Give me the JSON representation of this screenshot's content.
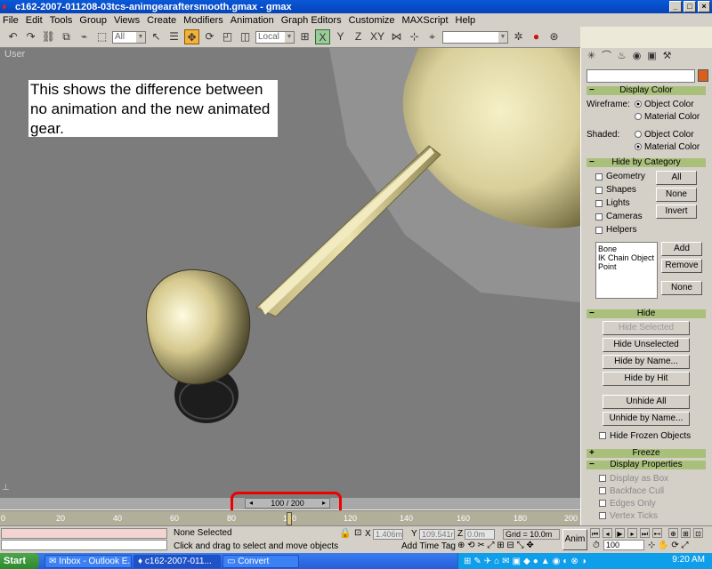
{
  "window": {
    "title": "c162-2007-011208-03tcs-animgearaftersmooth.gmax - gmax",
    "buttons": [
      "_",
      "□",
      "×"
    ]
  },
  "menu": [
    "File",
    "Edit",
    "Tools",
    "Group",
    "Views",
    "Create",
    "Modifiers",
    "Animation",
    "Graph Editors",
    "Customize",
    "MAXScript",
    "Help"
  ],
  "toolbar": {
    "filter_select": "All",
    "coord_select": "Local",
    "axis_labels": [
      "X",
      "Y",
      "Z",
      "XY"
    ]
  },
  "viewport": {
    "label": "User",
    "note": "This shows the difference between no animation and the new animated gear."
  },
  "command_panel": {
    "display_color": {
      "title": "Display Color",
      "wireframe_label": "Wireframe:",
      "shaded_label": "Shaded:",
      "object_color": "Object Color",
      "material_color": "Material Color"
    },
    "hide_by_category": {
      "title": "Hide by Category",
      "checks": [
        "Geometry",
        "Shapes",
        "Lights",
        "Cameras",
        "Helpers"
      ],
      "all": "All",
      "none": "None",
      "invert": "Invert",
      "list_items": [
        "Bone",
        "IK Chain Object",
        "Point"
      ],
      "add": "Add",
      "remove": "Remove",
      "none2": "None"
    },
    "hide": {
      "title": "Hide",
      "hide_selected": "Hide Selected",
      "hide_unselected": "Hide Unselected",
      "hide_by_name": "Hide by Name...",
      "hide_by_hit": "Hide by Hit",
      "unhide_all": "Unhide All",
      "unhide_by_name": "Unhide by Name...",
      "hide_frozen": "Hide Frozen Objects"
    },
    "freeze": {
      "title": "Freeze"
    },
    "display_properties": {
      "title": "Display Properties",
      "items": [
        "Display as Box",
        "Backface Cull",
        "Edges Only",
        "Vertex Ticks"
      ]
    }
  },
  "timeline": {
    "frame_counter": "100 / 200",
    "ticks": [
      "0",
      "20",
      "40",
      "60",
      "80",
      "100",
      "120",
      "140",
      "160",
      "180",
      "200"
    ],
    "current_frame": 100,
    "total_frames": 200
  },
  "status": {
    "selection": "None Selected",
    "prompt": "Click and drag to select and move objects",
    "x_label": "X",
    "x_value": "1.406m",
    "y_label": "Y",
    "y_value": "109.541r",
    "z_label": "Z",
    "z_value": "0.0m",
    "grid": "Grid = 10.0m",
    "add_time_tag": "Add Time Tag",
    "anim_button": "Anim",
    "frame_input": "100"
  },
  "taskbar": {
    "start": "Start",
    "tasks": [
      "Inbox - Outlook E...",
      "c162-2007-011...",
      "Convert"
    ],
    "clock": "9:20 AM"
  },
  "colors": {
    "rollout_header": "#a9c07a",
    "highlight_circle": "#e00000",
    "viewport_bg": "#7c7c7c",
    "model_tan": "#d8cf9a"
  }
}
